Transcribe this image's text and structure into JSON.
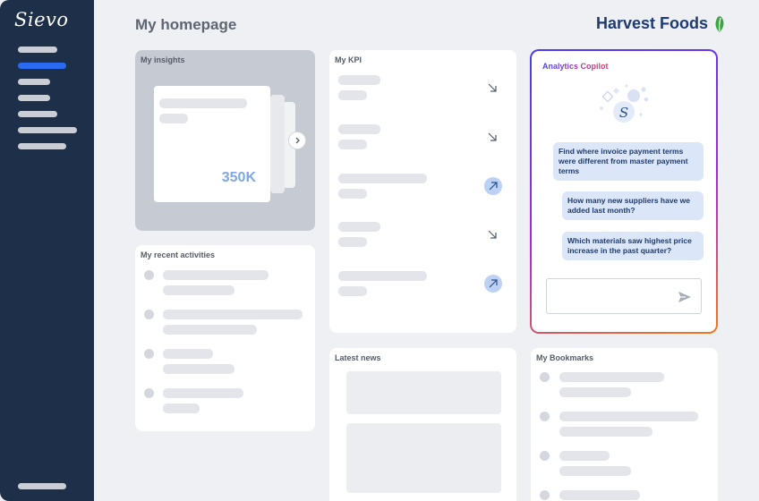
{
  "sidebar": {
    "logo": "Sievo",
    "nav_items": [
      "nav-item-1",
      "nav-item-2",
      "nav-item-3",
      "nav-item-4",
      "nav-item-5",
      "nav-item-6",
      "nav-item-7"
    ],
    "active_index": 1
  },
  "header": {
    "title": "My homepage",
    "brand_name": "Harvest Foods",
    "brand_color": "#1d3a72",
    "leaf_color": "#3aa83f"
  },
  "insights": {
    "title": "My insights",
    "value": "350K",
    "next_icon": "chevron-right-icon"
  },
  "kpi": {
    "title": "My KPI",
    "rows": [
      {
        "trend": "down",
        "icon": "arrow-down-right-icon"
      },
      {
        "trend": "down",
        "icon": "arrow-down-right-icon"
      },
      {
        "trend": "up",
        "icon": "arrow-up-right-icon"
      },
      {
        "trend": "down",
        "icon": "arrow-down-right-icon"
      },
      {
        "trend": "up",
        "icon": "arrow-up-right-icon"
      }
    ]
  },
  "copilot": {
    "title": "Analytics Copilot",
    "avatar_letter": "S",
    "suggestions": [
      "Find where invoice payment terms were different from master payment terms",
      "How many new suppliers have we added last month?",
      "Which materials saw highest price increase in the past quarter?"
    ],
    "input_value": "",
    "send_icon": "send-icon",
    "gradient": [
      "#4a3cf0",
      "#a02ad6",
      "#f07a1c"
    ]
  },
  "activities": {
    "title": "My recent activities"
  },
  "news": {
    "title": "Latest news"
  },
  "bookmarks": {
    "title": "My Bookmarks"
  }
}
